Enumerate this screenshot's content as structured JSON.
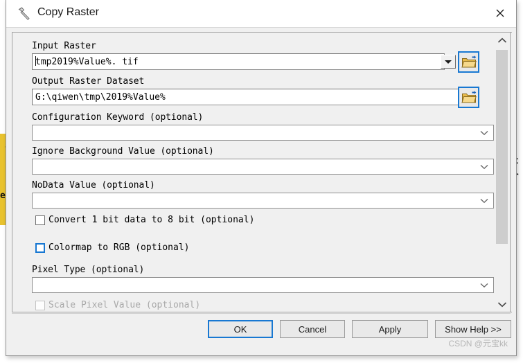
{
  "window": {
    "title": "Copy Raster",
    "icon": "hammer-tool-icon",
    "close_label": "×"
  },
  "background": {
    "yellow_popup_text": "en",
    "right_edge_lines": [
      "ut",
      "er",
      "e"
    ]
  },
  "form": {
    "fields": [
      {
        "label": "Input Raster",
        "value": "tmp2019%Value%. tif",
        "type": "combo-text-classic",
        "browse": true,
        "name": "input-raster"
      },
      {
        "label": "Output Raster Dataset",
        "value": "G:\\qiwen\\tmp\\2019%Value%",
        "type": "text",
        "browse": true,
        "name": "output-raster-dataset"
      },
      {
        "label": "Configuration Keyword (optional)",
        "value": "",
        "type": "combo",
        "browse": false,
        "name": "configuration-keyword"
      },
      {
        "label": "Ignore Background Value (optional)",
        "value": "",
        "type": "combo",
        "browse": false,
        "name": "ignore-background-value"
      },
      {
        "label": "NoData Value (optional)",
        "value": "",
        "type": "combo",
        "browse": false,
        "name": "nodata-value"
      }
    ],
    "checkboxes": [
      {
        "label": "Convert 1 bit data to 8 bit (optional)",
        "checked": false,
        "focused": false,
        "disabled": false,
        "name": "convert-1bit-to-8bit"
      },
      {
        "label": "Colormap to RGB (optional)",
        "checked": false,
        "focused": true,
        "disabled": false,
        "name": "colormap-to-rgb"
      },
      {
        "label": "Scale Pixel Value (optional)",
        "checked": false,
        "focused": false,
        "disabled": true,
        "name": "scale-pixel-value"
      }
    ],
    "pixel_type": {
      "label": "Pixel Type (optional)",
      "value": "",
      "name": "pixel-type"
    }
  },
  "footer": {
    "buttons": [
      {
        "label": "OK",
        "primary": true,
        "name": "ok-button"
      },
      {
        "label": "Cancel",
        "primary": false,
        "name": "cancel-button"
      },
      {
        "label": "Apply",
        "primary": false,
        "name": "apply-button"
      },
      {
        "label": "Show Help >>",
        "primary": false,
        "name": "show-help-button"
      }
    ],
    "watermark": "CSDN @元宝kk"
  },
  "scrollbar": {
    "up_icon": "chevron-up-icon",
    "down_icon": "chevron-down-icon"
  },
  "colors": {
    "accent": "#1878d2",
    "dialog_bg": "#f0f0f0",
    "folder": "#f0c040",
    "popup_yellow": "#e8c22e"
  }
}
